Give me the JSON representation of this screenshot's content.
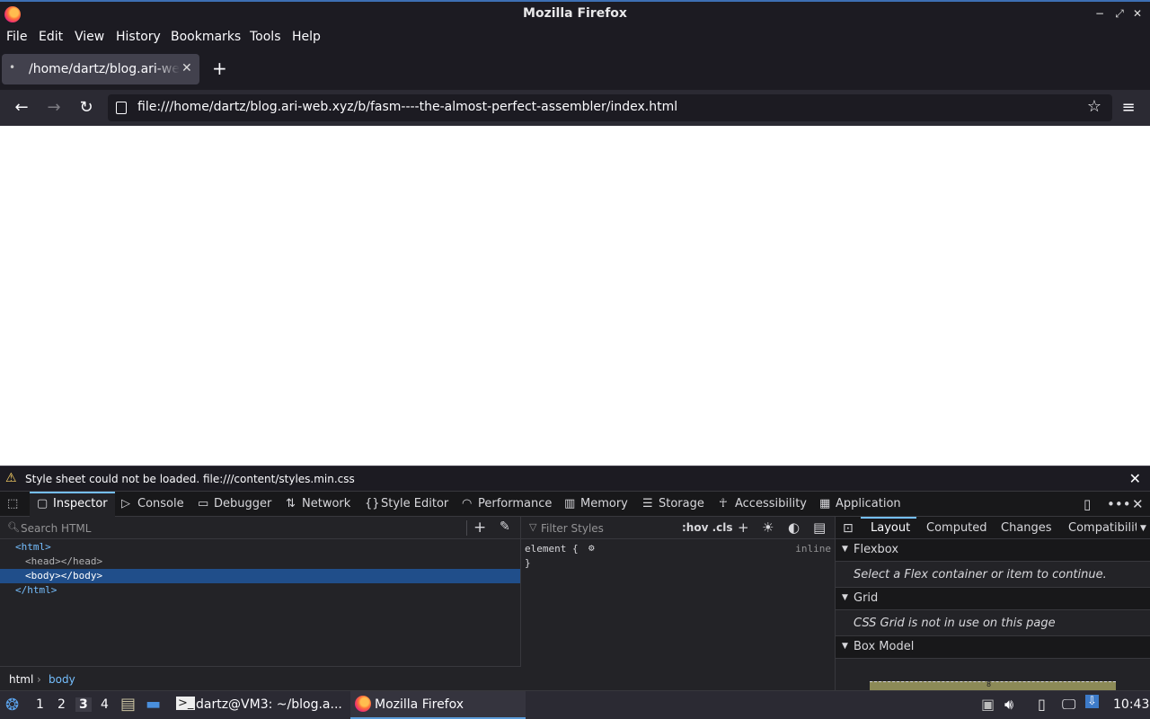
{
  "window": {
    "title": "Mozilla Firefox"
  },
  "menu": [
    "File",
    "Edit",
    "View",
    "History",
    "Bookmarks",
    "Tools",
    "Help"
  ],
  "tab": {
    "title": "/home/dartz/blog.ari-web.xyz/b/fasm----the-almost-perfect-assembler/index.html"
  },
  "nav": {
    "url": "file:///home/dartz/blog.ari-web.xyz/b/fasm----the-almost-perfect-assembler/index.html"
  },
  "notification": {
    "message": "Style sheet could not be loaded. file:///content/styles.min.css"
  },
  "devtools": {
    "tabs": [
      "Inspector",
      "Console",
      "Debugger",
      "Network",
      "Style Editor",
      "Performance",
      "Memory",
      "Storage",
      "Accessibility",
      "Application"
    ],
    "markup": {
      "search_placeholder": "Search HTML",
      "nodes": [
        "<html>",
        "<head></head>",
        "<body></body>",
        "</html>"
      ],
      "breadcrumb": [
        "html",
        "body"
      ]
    },
    "rules": {
      "filter_placeholder": "Filter Styles",
      "pseudo": ":hov .cls",
      "rule_line1": "element {",
      "rule_line2": "}",
      "source": "inline"
    },
    "sidebar": {
      "tabs": [
        "Layout",
        "Computed",
        "Changes",
        "Compatibility"
      ],
      "sections": [
        {
          "title": "Flexbox",
          "body": "Select a Flex container or item to continue."
        },
        {
          "title": "Grid",
          "body": "CSS Grid is not in use on this page"
        },
        {
          "title": "Box Model",
          "body": ""
        }
      ],
      "box_margin": "8"
    }
  },
  "taskbar": {
    "workspaces": [
      "1",
      "2",
      "3",
      "4"
    ],
    "active_workspace": "3",
    "windows": [
      "dartz@VM3: ~/blog.a...",
      "Mozilla Firefox"
    ],
    "clock": "10:43"
  },
  "colors": {
    "accent": "#75bfff",
    "selection": "#204e8a",
    "warning": "#ffd567"
  }
}
